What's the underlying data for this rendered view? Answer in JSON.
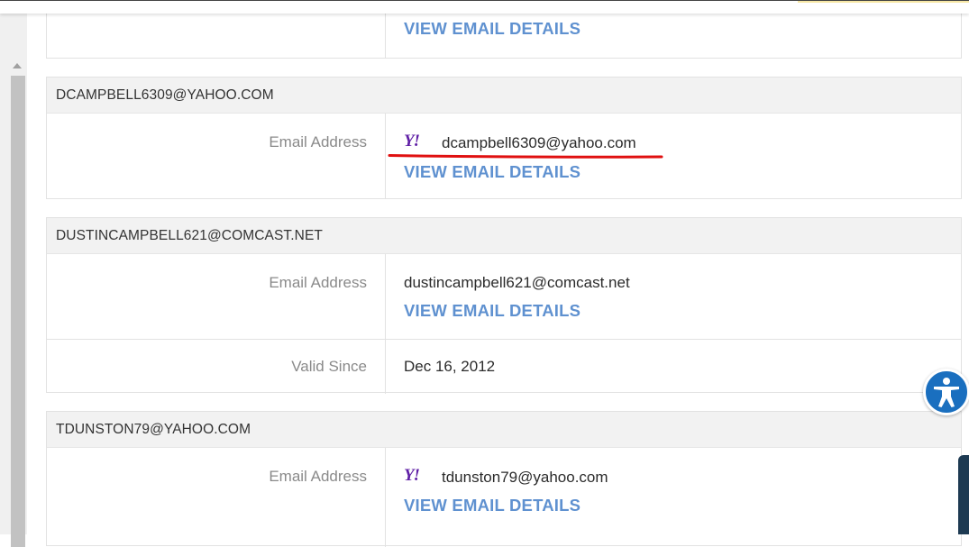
{
  "cards": [
    {
      "rows": [
        {
          "link": "VIEW EMAIL DETAILS"
        }
      ]
    },
    {
      "header": "DCAMPBELL6309@YAHOO.COM",
      "email_label": "Email Address",
      "email": "dcampbell6309@yahoo.com",
      "icon": "yahoo-icon",
      "link": "VIEW EMAIL DETAILS"
    },
    {
      "header": "DUSTINCAMPBELL621@COMCAST.NET",
      "email_label": "Email Address",
      "email": "dustincampbell621@comcast.net",
      "link": "VIEW EMAIL DETAILS",
      "valid_label": "Valid Since",
      "valid_value": "Dec 16, 2012"
    },
    {
      "header": "TDUNSTON79@YAHOO.COM",
      "email_label": "Email Address",
      "email": "tdunston79@yahoo.com",
      "icon": "yahoo-icon",
      "link": "VIEW EMAIL DETAILS"
    }
  ],
  "yahoo_glyph": "Y!",
  "colors": {
    "link": "#5f91d0",
    "yahoo": "#5f1fa6",
    "annotation": "#e01010",
    "accessibility": "#1a6fbf"
  }
}
